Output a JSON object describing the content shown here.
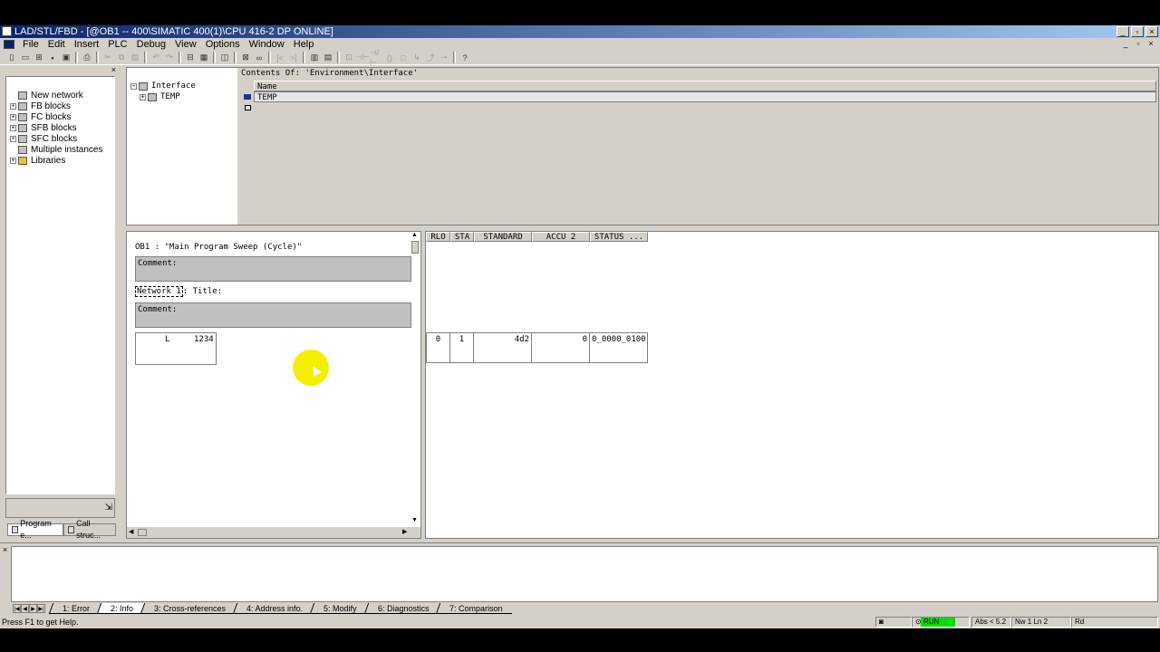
{
  "window": {
    "title": "LAD/STL/FBD  - [@OB1 -- 400\\SIMATIC 400(1)\\CPU 416-2 DP  ONLINE]"
  },
  "menu": [
    "File",
    "Edit",
    "Insert",
    "PLC",
    "Debug",
    "View",
    "Options",
    "Window",
    "Help"
  ],
  "left_tree": {
    "items": [
      {
        "label": "New network",
        "expandable": false
      },
      {
        "label": "FB blocks",
        "expandable": true
      },
      {
        "label": "FC blocks",
        "expandable": true
      },
      {
        "label": "SFB blocks",
        "expandable": true
      },
      {
        "label": "SFC blocks",
        "expandable": true
      },
      {
        "label": "Multiple instances",
        "expandable": false
      },
      {
        "label": "Libraries",
        "expandable": true
      }
    ],
    "tabs": [
      "Program e...",
      "Call struc..."
    ]
  },
  "interface": {
    "tree": [
      "Interface",
      "TEMP"
    ],
    "contents_title": "Contents Of: 'Environment\\Interface'",
    "column_header": "Name",
    "rows": [
      "TEMP",
      ""
    ]
  },
  "code": {
    "ob_header": "OB1 :  \"Main Program Sweep (Cycle)\"",
    "comment_label": "Comment:",
    "network_label": "Network 1",
    "network_title": ": Title:",
    "network_comment_label": "Comment:",
    "stl_op": "L",
    "stl_arg": "1234"
  },
  "status_table": {
    "headers": [
      "RLO",
      "STA",
      "STANDARD",
      "ACCU 2",
      "STATUS ..."
    ],
    "row": [
      "0",
      "1",
      "4d2",
      "0",
      "0_0000_0100"
    ]
  },
  "output_tabs": [
    "1: Error",
    "2: Info",
    "3: Cross-references",
    "4: Address info.",
    "5: Modify",
    "6: Diagnostics",
    "7: Comparison"
  ],
  "statusbar": {
    "help": "Press F1 to get Help.",
    "mode": "RUN",
    "position": "Abs < 5.2",
    "network": "Nw 1 Ln 2",
    "access": "Rd"
  }
}
